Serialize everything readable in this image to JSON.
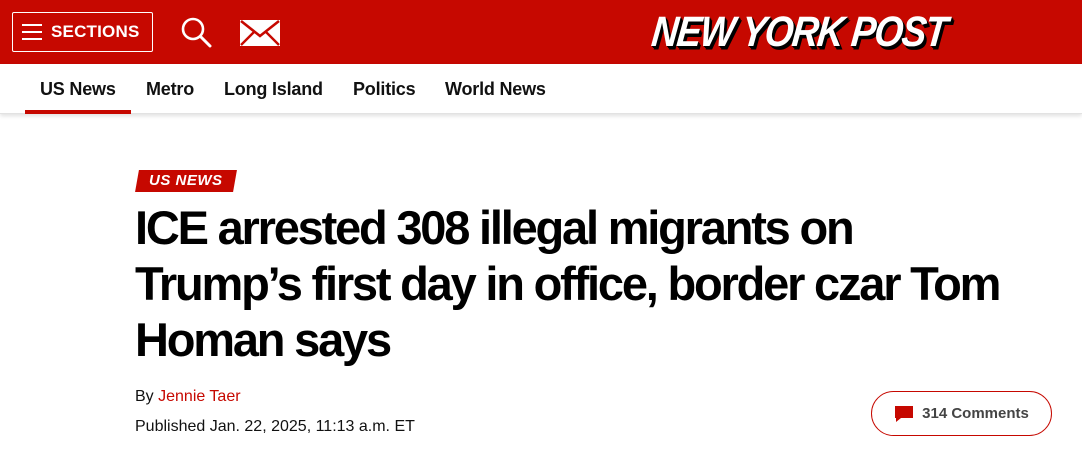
{
  "header": {
    "sections_label": "SECTIONS",
    "logo_text": "NEW YORK POST",
    "icons": [
      "hamburger-icon",
      "search-icon",
      "mail-icon"
    ],
    "brand_color": "#c60800"
  },
  "nav": {
    "items": [
      {
        "label": "US News",
        "active": true
      },
      {
        "label": "Metro",
        "active": false
      },
      {
        "label": "Long Island",
        "active": false
      },
      {
        "label": "Politics",
        "active": false
      },
      {
        "label": "World News",
        "active": false
      }
    ]
  },
  "article": {
    "kicker": "US NEWS",
    "headline": "ICE arrested 308 illegal migrants on Trump’s first day in office, border czar Tom Homan says",
    "byline_prefix": "By",
    "author": "Jennie Taer",
    "published": "Published Jan. 22, 2025, 11:13 a.m. ET",
    "comments_label": "314 Comments"
  }
}
